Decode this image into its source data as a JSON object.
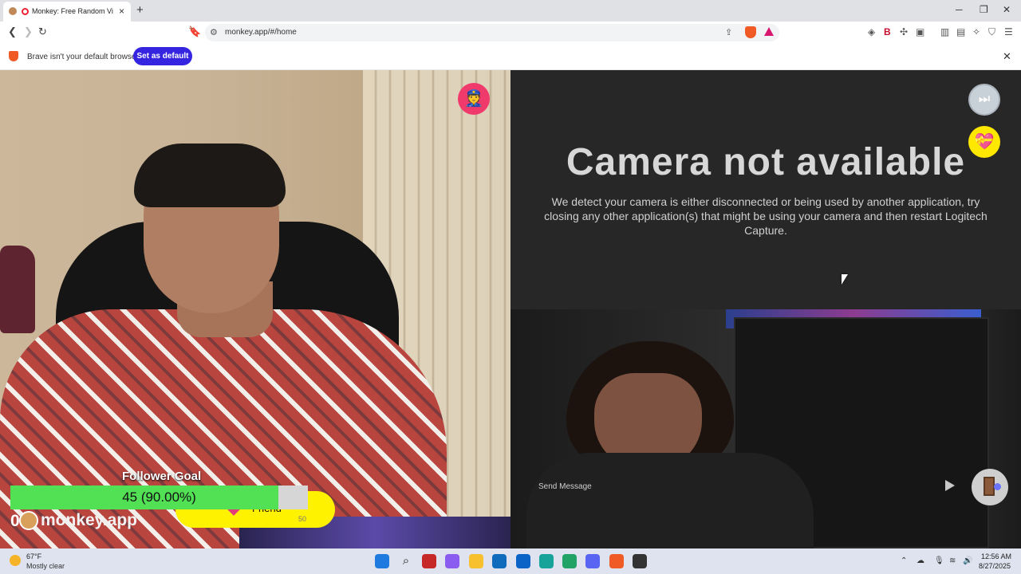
{
  "browser": {
    "tab_title": "Monkey: Free Random Video Chat",
    "new_tab_glyph": "+",
    "tab_close_glyph": "×",
    "url": "monkey.app/#/home",
    "window_controls": [
      "─",
      "❐",
      "✕"
    ]
  },
  "infobar": {
    "message": "Brave isn't your default browser",
    "button_label": "Set as default",
    "close_glyph": "✕"
  },
  "camera_error": {
    "heading": "Camera not available",
    "body": "We detect your camera is either disconnected or being used by another application, try closing any other application(s) that might be using your camera and then restart Logitech Capture."
  },
  "follower_goal": {
    "label": "Follower Goal",
    "value_text": "45 (90.00%)",
    "progress": 0.9
  },
  "friend_button": {
    "label": "Friend",
    "count": "50"
  },
  "brand": {
    "count": "0",
    "name": "monkey.app"
  },
  "chat": {
    "placeholder": "Send Message"
  },
  "icons": {
    "police": "👮",
    "skip": "⏭",
    "heart": "💝"
  },
  "weather": {
    "temperature": "67°F",
    "condition": "Mostly clear"
  },
  "clock": {
    "time": "12:56 AM",
    "date": "8/27/2025"
  },
  "colors": {
    "set_default_button": "#3524e0",
    "goal_fill": "#52e054",
    "friend_button": "#fff200",
    "heart_button": "#ffe800",
    "police_button": "#f03a6c"
  }
}
